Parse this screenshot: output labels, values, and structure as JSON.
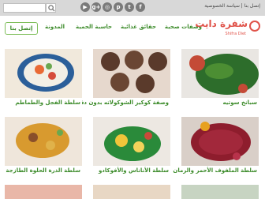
{
  "topbar": {
    "search_placeholder": "",
    "social_icons": [
      {
        "name": "facebook-icon",
        "glyph": "f"
      },
      {
        "name": "twitter-icon",
        "glyph": "t"
      },
      {
        "name": "pinterest-icon",
        "glyph": "p"
      },
      {
        "name": "instagram-icon",
        "glyph": "◎"
      },
      {
        "name": "google-plus-icon",
        "glyph": "g+"
      },
      {
        "name": "youtube-icon",
        "glyph": "▶"
      }
    ],
    "links": "إتصل بنا | سياسة الخصوصية"
  },
  "brand": {
    "name": "شفرة دايت",
    "tagline": "Shifra Diet"
  },
  "nav": {
    "items": [
      "وصفات صحية",
      "حقائق غذائية",
      "حاسبة الحمية",
      "المدونة"
    ],
    "signup": "إتصل بنا"
  },
  "cards": [
    {
      "title": "سبانخ سوتيه",
      "colors": [
        "#c44a36",
        "#2d6d2b",
        "#e9e6e2"
      ]
    },
    {
      "title": "وصفة كوكيز الشوكولاته بدون دقيق",
      "colors": [
        "#c0a392",
        "#5a3a2b",
        "#e6d8cd"
      ]
    },
    {
      "title": "سلطة الفجل والطماطم",
      "colors": [
        "#2b5f9a",
        "#e96a35",
        "#f1e9dc"
      ]
    },
    {
      "title": "سلطة الملفوف الأحمر والرمان",
      "colors": [
        "#8e1d2d",
        "#d9cfc8",
        "#e7a11f"
      ]
    },
    {
      "title": "سلطة الأناناس والأفوكادو",
      "colors": [
        "#2a8a3a",
        "#f0c53a",
        "#ede8e2"
      ]
    },
    {
      "title": "سلطة الذرة الحلوة الطازجة",
      "colors": [
        "#d89a2f",
        "#8a4f2a",
        "#efe6db"
      ]
    }
  ]
}
